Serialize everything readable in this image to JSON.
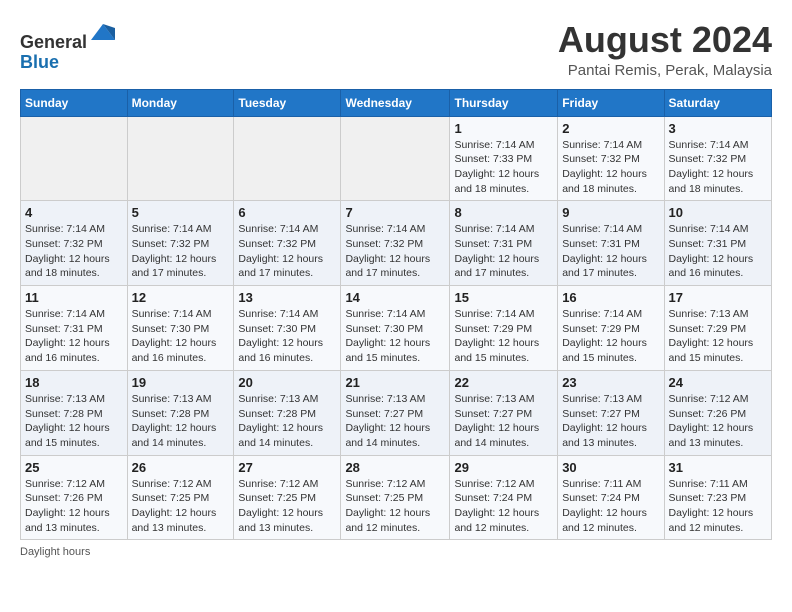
{
  "header": {
    "logo_general": "General",
    "logo_blue": "Blue",
    "month_year": "August 2024",
    "location": "Pantai Remis, Perak, Malaysia"
  },
  "weekdays": [
    "Sunday",
    "Monday",
    "Tuesday",
    "Wednesday",
    "Thursday",
    "Friday",
    "Saturday"
  ],
  "weeks": [
    [
      {
        "day": "",
        "info": ""
      },
      {
        "day": "",
        "info": ""
      },
      {
        "day": "",
        "info": ""
      },
      {
        "day": "",
        "info": ""
      },
      {
        "day": "1",
        "info": "Sunrise: 7:14 AM\nSunset: 7:33 PM\nDaylight: 12 hours and 18 minutes."
      },
      {
        "day": "2",
        "info": "Sunrise: 7:14 AM\nSunset: 7:32 PM\nDaylight: 12 hours and 18 minutes."
      },
      {
        "day": "3",
        "info": "Sunrise: 7:14 AM\nSunset: 7:32 PM\nDaylight: 12 hours and 18 minutes."
      }
    ],
    [
      {
        "day": "4",
        "info": "Sunrise: 7:14 AM\nSunset: 7:32 PM\nDaylight: 12 hours and 18 minutes."
      },
      {
        "day": "5",
        "info": "Sunrise: 7:14 AM\nSunset: 7:32 PM\nDaylight: 12 hours and 17 minutes."
      },
      {
        "day": "6",
        "info": "Sunrise: 7:14 AM\nSunset: 7:32 PM\nDaylight: 12 hours and 17 minutes."
      },
      {
        "day": "7",
        "info": "Sunrise: 7:14 AM\nSunset: 7:32 PM\nDaylight: 12 hours and 17 minutes."
      },
      {
        "day": "8",
        "info": "Sunrise: 7:14 AM\nSunset: 7:31 PM\nDaylight: 12 hours and 17 minutes."
      },
      {
        "day": "9",
        "info": "Sunrise: 7:14 AM\nSunset: 7:31 PM\nDaylight: 12 hours and 17 minutes."
      },
      {
        "day": "10",
        "info": "Sunrise: 7:14 AM\nSunset: 7:31 PM\nDaylight: 12 hours and 16 minutes."
      }
    ],
    [
      {
        "day": "11",
        "info": "Sunrise: 7:14 AM\nSunset: 7:31 PM\nDaylight: 12 hours and 16 minutes."
      },
      {
        "day": "12",
        "info": "Sunrise: 7:14 AM\nSunset: 7:30 PM\nDaylight: 12 hours and 16 minutes."
      },
      {
        "day": "13",
        "info": "Sunrise: 7:14 AM\nSunset: 7:30 PM\nDaylight: 12 hours and 16 minutes."
      },
      {
        "day": "14",
        "info": "Sunrise: 7:14 AM\nSunset: 7:30 PM\nDaylight: 12 hours and 15 minutes."
      },
      {
        "day": "15",
        "info": "Sunrise: 7:14 AM\nSunset: 7:29 PM\nDaylight: 12 hours and 15 minutes."
      },
      {
        "day": "16",
        "info": "Sunrise: 7:14 AM\nSunset: 7:29 PM\nDaylight: 12 hours and 15 minutes."
      },
      {
        "day": "17",
        "info": "Sunrise: 7:13 AM\nSunset: 7:29 PM\nDaylight: 12 hours and 15 minutes."
      }
    ],
    [
      {
        "day": "18",
        "info": "Sunrise: 7:13 AM\nSunset: 7:28 PM\nDaylight: 12 hours and 15 minutes."
      },
      {
        "day": "19",
        "info": "Sunrise: 7:13 AM\nSunset: 7:28 PM\nDaylight: 12 hours and 14 minutes."
      },
      {
        "day": "20",
        "info": "Sunrise: 7:13 AM\nSunset: 7:28 PM\nDaylight: 12 hours and 14 minutes."
      },
      {
        "day": "21",
        "info": "Sunrise: 7:13 AM\nSunset: 7:27 PM\nDaylight: 12 hours and 14 minutes."
      },
      {
        "day": "22",
        "info": "Sunrise: 7:13 AM\nSunset: 7:27 PM\nDaylight: 12 hours and 14 minutes."
      },
      {
        "day": "23",
        "info": "Sunrise: 7:13 AM\nSunset: 7:27 PM\nDaylight: 12 hours and 13 minutes."
      },
      {
        "day": "24",
        "info": "Sunrise: 7:12 AM\nSunset: 7:26 PM\nDaylight: 12 hours and 13 minutes."
      }
    ],
    [
      {
        "day": "25",
        "info": "Sunrise: 7:12 AM\nSunset: 7:26 PM\nDaylight: 12 hours and 13 minutes."
      },
      {
        "day": "26",
        "info": "Sunrise: 7:12 AM\nSunset: 7:25 PM\nDaylight: 12 hours and 13 minutes."
      },
      {
        "day": "27",
        "info": "Sunrise: 7:12 AM\nSunset: 7:25 PM\nDaylight: 12 hours and 13 minutes."
      },
      {
        "day": "28",
        "info": "Sunrise: 7:12 AM\nSunset: 7:25 PM\nDaylight: 12 hours and 12 minutes."
      },
      {
        "day": "29",
        "info": "Sunrise: 7:12 AM\nSunset: 7:24 PM\nDaylight: 12 hours and 12 minutes."
      },
      {
        "day": "30",
        "info": "Sunrise: 7:11 AM\nSunset: 7:24 PM\nDaylight: 12 hours and 12 minutes."
      },
      {
        "day": "31",
        "info": "Sunrise: 7:11 AM\nSunset: 7:23 PM\nDaylight: 12 hours and 12 minutes."
      }
    ]
  ],
  "footer": "Daylight hours"
}
